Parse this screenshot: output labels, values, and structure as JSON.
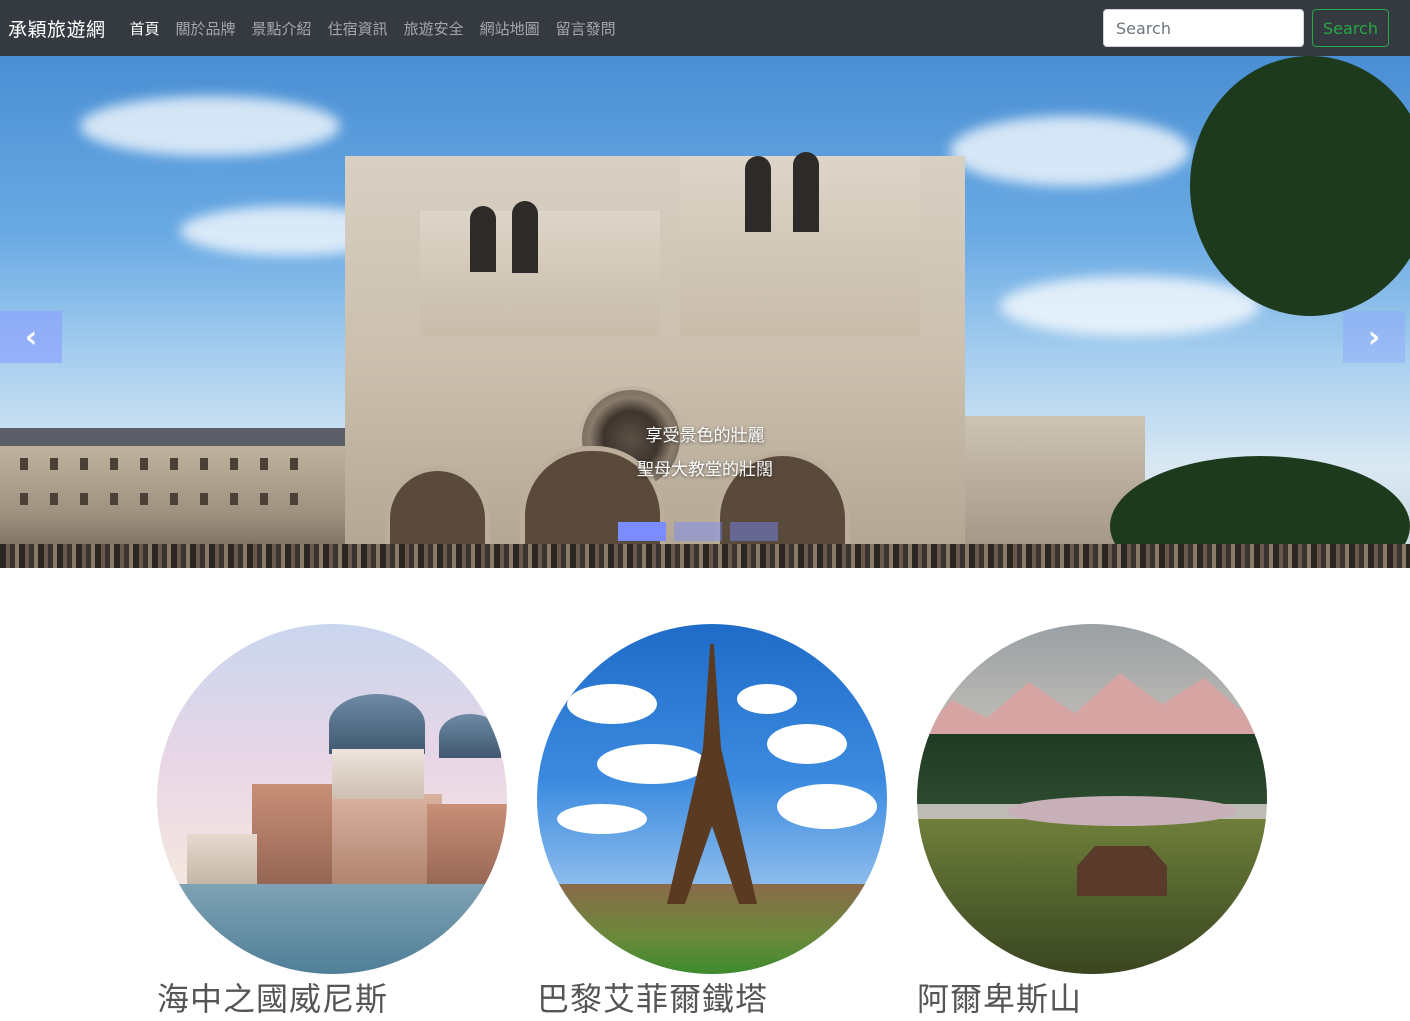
{
  "navbar": {
    "brand": "承穎旅遊網",
    "items": [
      {
        "label": "首頁",
        "active": true
      },
      {
        "label": "關於品牌",
        "active": false
      },
      {
        "label": "景點介紹",
        "active": false
      },
      {
        "label": "住宿資訊",
        "active": false
      },
      {
        "label": "旅遊安全",
        "active": false
      },
      {
        "label": "網站地圖",
        "active": false
      },
      {
        "label": "留言發問",
        "active": false
      }
    ],
    "search": {
      "placeholder": "Search",
      "button_label": "Search"
    }
  },
  "carousel": {
    "caption_line1": "享受景色的壯麗",
    "caption_line2": "聖母大教堂的壯闊",
    "indicator_count": 3,
    "active_index": 0,
    "prev_icon": "chevron-left-icon",
    "next_icon": "chevron-right-icon"
  },
  "features": [
    {
      "title": "海中之國威尼斯",
      "image": "venice"
    },
    {
      "title": "巴黎艾菲爾鐵塔",
      "image": "eiffel-tower"
    },
    {
      "title": "阿爾卑斯山",
      "image": "alps"
    }
  ],
  "colors": {
    "navbar_bg": "#343a40",
    "search_accent": "#28a745",
    "indicator_active": "#7a8cff"
  }
}
